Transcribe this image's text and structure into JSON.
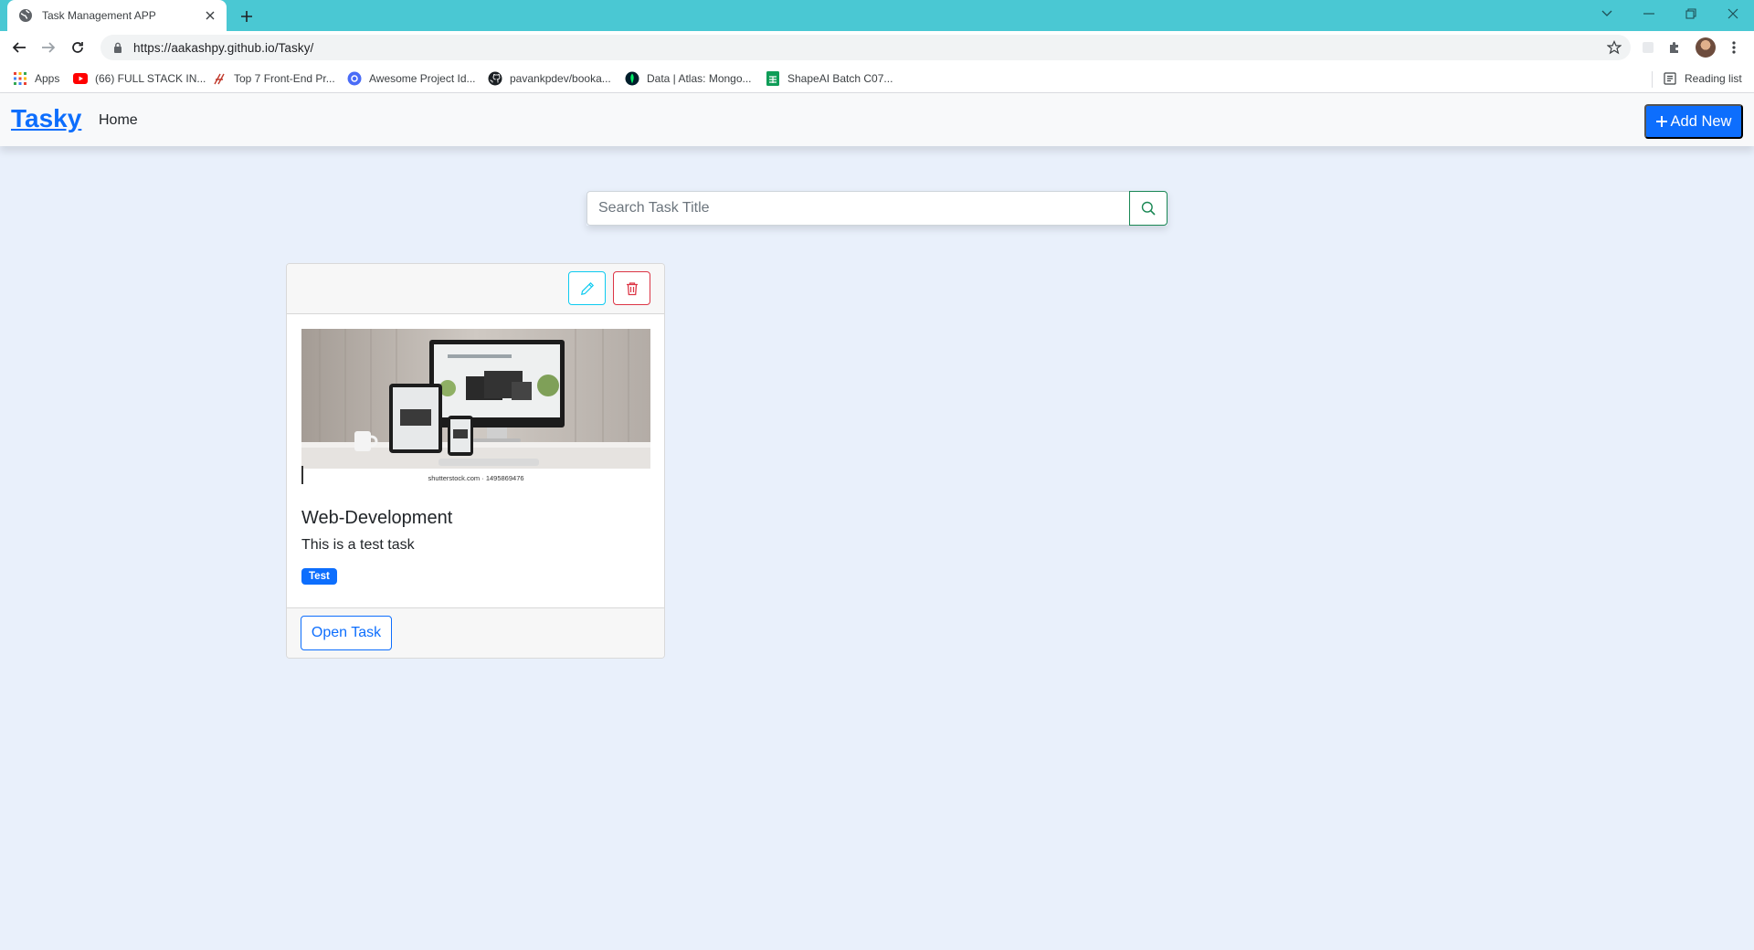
{
  "browser": {
    "tab_title": "Task Management APP",
    "url": "https://aakashpy.github.io/Tasky/",
    "bookmarks": [
      {
        "label": "Apps",
        "icon": "apps-grid-icon"
      },
      {
        "label": "(66) FULL STACK IN...",
        "icon": "youtube-icon"
      },
      {
        "label": "Top 7 Front-End Pr...",
        "icon": "bookmark-favicon-icon"
      },
      {
        "label": "Awesome Project Id...",
        "icon": "globe-icon"
      },
      {
        "label": "pavankpdev/booka...",
        "icon": "github-icon"
      },
      {
        "label": "Data | Atlas: Mongo...",
        "icon": "mongodb-icon"
      },
      {
        "label": "ShapeAI Batch C07...",
        "icon": "sheets-icon"
      }
    ],
    "reading_list": "Reading list"
  },
  "navbar": {
    "brand": "Tasky",
    "home": "Home",
    "add_new": "Add New"
  },
  "search": {
    "placeholder": "Search Task Title"
  },
  "task": {
    "image_caption": "shutterstock.com · 1495869476",
    "title": "Web-Development",
    "description": "This is a test task",
    "tag": "Test",
    "open_label": "Open Task"
  },
  "colors": {
    "primary": "#0d6efd",
    "info": "#0dcaf0",
    "danger": "#dc3545",
    "success": "#198754",
    "page_bg": "#e9f0fb",
    "tab_strip": "#4ac8d3"
  }
}
